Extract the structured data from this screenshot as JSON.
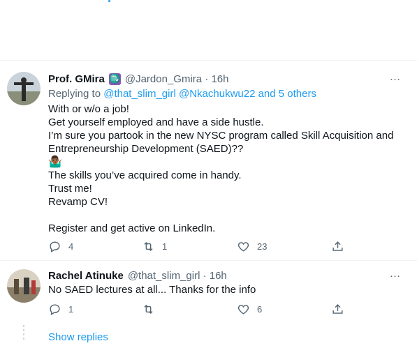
{
  "tweets": [
    {
      "author_name": "Prof. GMira",
      "name_badge": "♏",
      "handle_time": "@Jardon_Gmira · 16h",
      "replying_prefix": "Replying to ",
      "replying_links": "@that_slim_girl @Nkachukwu22 and 5 others",
      "lines": [
        "With or w/o a job!",
        "Get yourself employed and have a side hustle.",
        "I’m sure you partook in the new NYSC program called Skill Acquisition and",
        "Entrepreneurship Development (SAED)??",
        "🤷🏾‍♂️",
        "The skills you’ve acquired come in handy.",
        "Trust me!",
        "Revamp CV!",
        "",
        "Register and get active on LinkedIn."
      ],
      "more_icon": "…",
      "reply_count": "4",
      "retweet_count": "1",
      "like_count": "23"
    },
    {
      "author_name": "Rachel Atinuke",
      "handle_time": "@that_slim_girl · 16h",
      "lines": [
        "No SAED lectures at all... Thanks for the info"
      ],
      "more_icon": "…",
      "reply_count": "1",
      "retweet_count": "",
      "like_count": "6"
    }
  ],
  "show_replies_label": "Show replies",
  "icons": {
    "reply": "reply-icon",
    "retweet": "retweet-icon",
    "like": "heart-icon",
    "share": "share-icon",
    "more": "more-icon"
  },
  "colors": {
    "link": "#1d9bf0",
    "muted": "#536471",
    "text": "#0f1419",
    "divider": "#eff3f4"
  }
}
